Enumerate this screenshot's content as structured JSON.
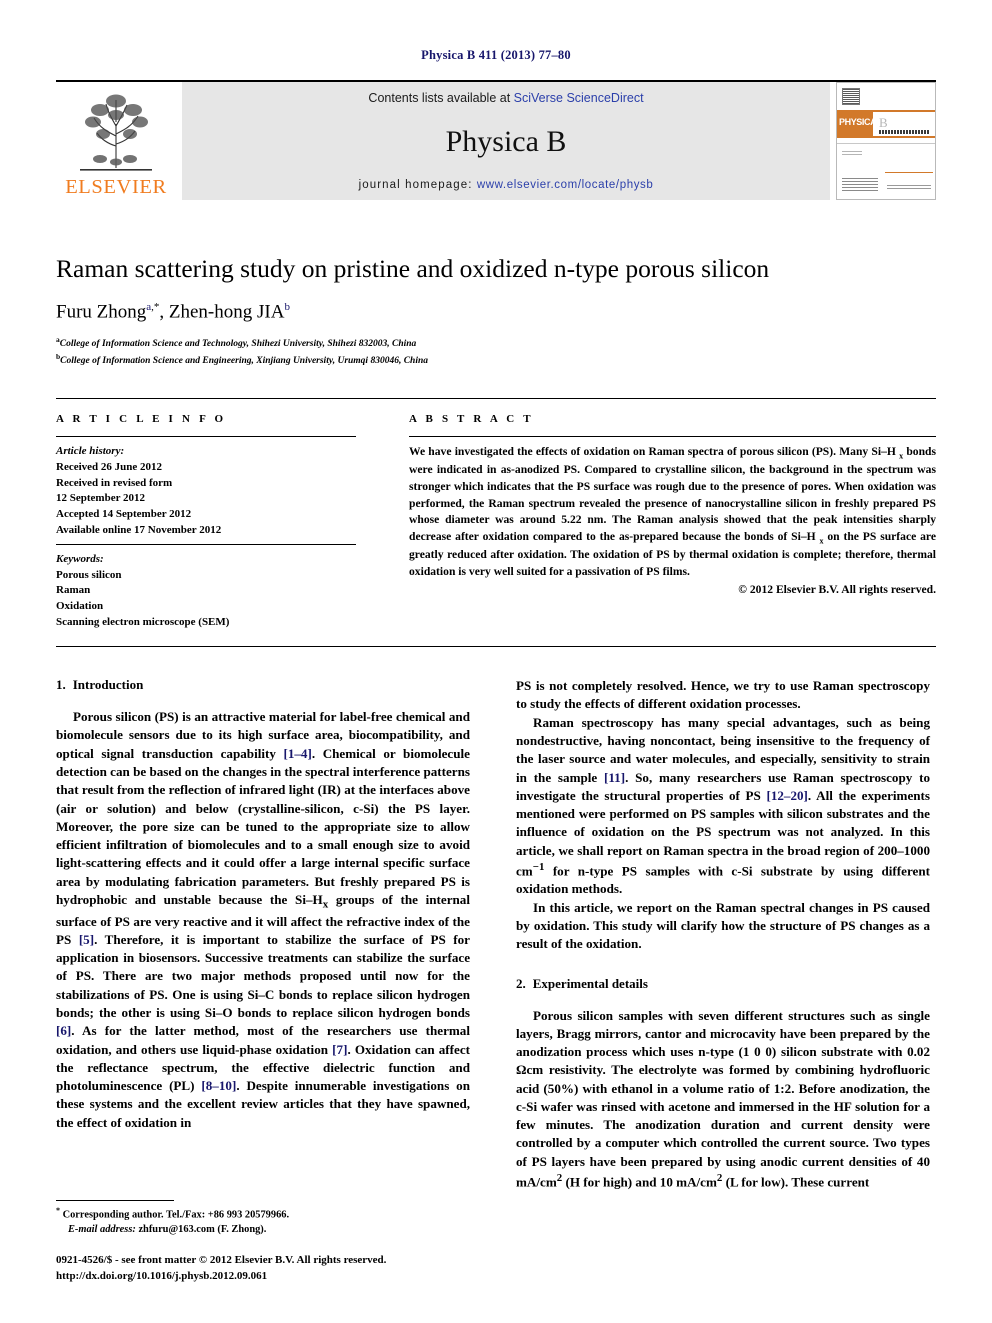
{
  "running_head": "Physica B 411 (2013) 77–80",
  "masthead": {
    "publisher_wordmark": "ELSEVIER",
    "contents_prefix": "Contents lists available at ",
    "contents_link": "SciVerse ScienceDirect",
    "journal_name": "Physica B",
    "homepage_prefix": "journal homepage: ",
    "homepage_link": "www.elsevier.com/locate/physb",
    "cover_physica": "PHYSICA",
    "cover_b": "B"
  },
  "article": {
    "title": "Raman scattering study on pristine and oxidized n-type porous silicon",
    "authors_html": "Furu Zhong<sup class=\"aff\">a</sup><sup class=\"star\">,*</sup>, Zhen-hong JIA<sup class=\"aff\">b</sup>",
    "author_plain": "Furu Zhong a,*, Zhen-hong JIA b",
    "affiliations": [
      {
        "marker": "a",
        "text": "College of Information Science and Technology, Shihezi University, Shihezi 832003, China"
      },
      {
        "marker": "b",
        "text": "College of Information Science and Engineering, Xinjiang University, Urumqi 830046, China"
      }
    ]
  },
  "info": {
    "heading": "A R T I C L E   I N F O",
    "history_label": "Article history:",
    "history": [
      "Received 26 June 2012",
      "Received in revised form",
      "12 September 2012",
      "Accepted 14 September 2012",
      "Available online 17 November 2012"
    ],
    "keywords_label": "Keywords:",
    "keywords": [
      "Porous silicon",
      "Raman",
      "Oxidation",
      "Scanning electron microscope (SEM)"
    ]
  },
  "abstract": {
    "heading": "A B S T R A C T",
    "text_html": "We have investigated the effects of oxidation on Raman spectra of porous silicon (PS). Many Si–H <sub>x</sub> bonds were indicated in as-anodized PS. Compared to crystalline silicon, the background in the spectrum was stronger which indicates that the PS surface was rough due to the presence of pores. When oxidation was performed, the Raman spectrum revealed the presence of nanocrystalline silicon in freshly prepared PS whose diameter was around 5.22 nm. The Raman analysis showed that the peak intensities sharply decrease after oxidation compared to the as-prepared because the bonds of Si–H <sub>x</sub> on the PS surface are greatly reduced after oxidation. The oxidation of PS by thermal oxidation is complete; therefore, thermal oxidation is very well suited for a passivation of PS films.",
    "copyright": "© 2012 Elsevier B.V. All rights reserved."
  },
  "sections": {
    "introduction": {
      "number": "1.",
      "title": "Introduction",
      "paragraph1_html": "Porous silicon (PS) is an attractive material for label-free chemical and biomolecule sensors due to its high surface area, biocompatibility, and optical signal transduction capability <span class=\"ref\">[1–4]</span>. Chemical or biomolecule detection can be based on the changes in the spectral interference patterns that result from the reflection of infrared light (IR) at the interfaces above (air or solution) and below (crystalline-silicon, c-Si) the PS layer. Moreover, the pore size can be tuned to the appropriate size to allow efficient infiltration of biomolecules and to a small enough size to avoid light-scattering effects and it could offer a large internal specific surface area by modulating fabrication parameters. But freshly prepared PS is hydrophobic and unstable because the Si–H<sub>x</sub> groups of the internal surface of PS are very reactive and it will affect the refractive index of the PS <span class=\"ref\">[5]</span>. Therefore, it is important to stabilize the surface of PS for application in biosensors. Successive treatments can stabilize the surface of PS. There are two major methods proposed until now for the stabilizations of PS. One is using Si–C bonds to replace silicon hydrogen bonds; the other is using Si–O bonds to replace silicon hydrogen bonds <span class=\"ref\">[6]</span>. As for the latter method, most of the researchers use thermal oxidation, and others use liquid-phase oxidation <span class=\"ref\">[7]</span>. Oxidation can affect the reflectance spectrum, the effective dielectric function and photoluminescence (PL) <span class=\"ref\">[8–10]</span>. Despite innumerable investigations on these systems and the excellent review articles that they have spawned, the effect of oxidation in PS is not completely resolved. Hence, we try to use Raman spectroscopy to study the effects of different oxidation processes.",
      "paragraph2_html": "Raman spectroscopy has many special advantages, such as being nondestructive, having noncontact, being insensitive to the frequency of the laser source and water molecules, and especially, sensitivity to strain in the sample <span class=\"ref\">[11]</span>. So, many researchers use Raman spectroscopy to investigate the structural properties of PS <span class=\"ref\">[12–20]</span>. All the experiments mentioned were performed on PS samples with silicon substrates and the influence of oxidation on the PS spectrum was not analyzed. In this article, we shall report on Raman spectra in the broad region of 200–1000 cm<sup>−1</sup> for n-type PS samples with c-Si substrate by using different oxidation methods.",
      "paragraph3_html": "In this article, we report on the Raman spectral changes in PS caused by oxidation. This study will clarify how the structure of PS changes as a result of the oxidation."
    },
    "experimental": {
      "number": "2.",
      "title": "Experimental details",
      "paragraph1_html": "Porous silicon samples with seven different structures such as single layers, Bragg mirrors, cantor and microcavity have been prepared by the anodization process which uses n-type (1 0 0) silicon substrate with 0.02 Ωcm resistivity. The electrolyte was formed by combining hydrofluoric acid (50%) with ethanol in a volume ratio of 1:2. Before anodization, the c-Si wafer was rinsed with acetone and immersed in the HF solution for a few minutes. The anodization duration and current density were controlled by a computer which controlled the current source. Two types of PS layers have been prepared by using anodic current densities of 40 mA/cm<sup>2</sup> (H for high) and 10 mA/cm<sup>2</sup> (L for low). These current"
    }
  },
  "footer": {
    "corresponding_html": "<sup>*</sup> Corresponding author. Tel./Fax: +86 993 20579966.",
    "email_html": "<span class=\"ital\">E-mail address:</span> zhfuru@163.com (F. Zhong).",
    "issn_line": "0921-4526/$ - see front matter © 2012 Elsevier B.V. All rights reserved.",
    "doi_line": "http://dx.doi.org/10.1016/j.physb.2012.09.061"
  },
  "colors": {
    "link_blue": "#2b3faa",
    "ref_blue": "#17166b",
    "elsevier_orange": "#f07c1f",
    "masthead_gray": "#e6e6e6"
  }
}
